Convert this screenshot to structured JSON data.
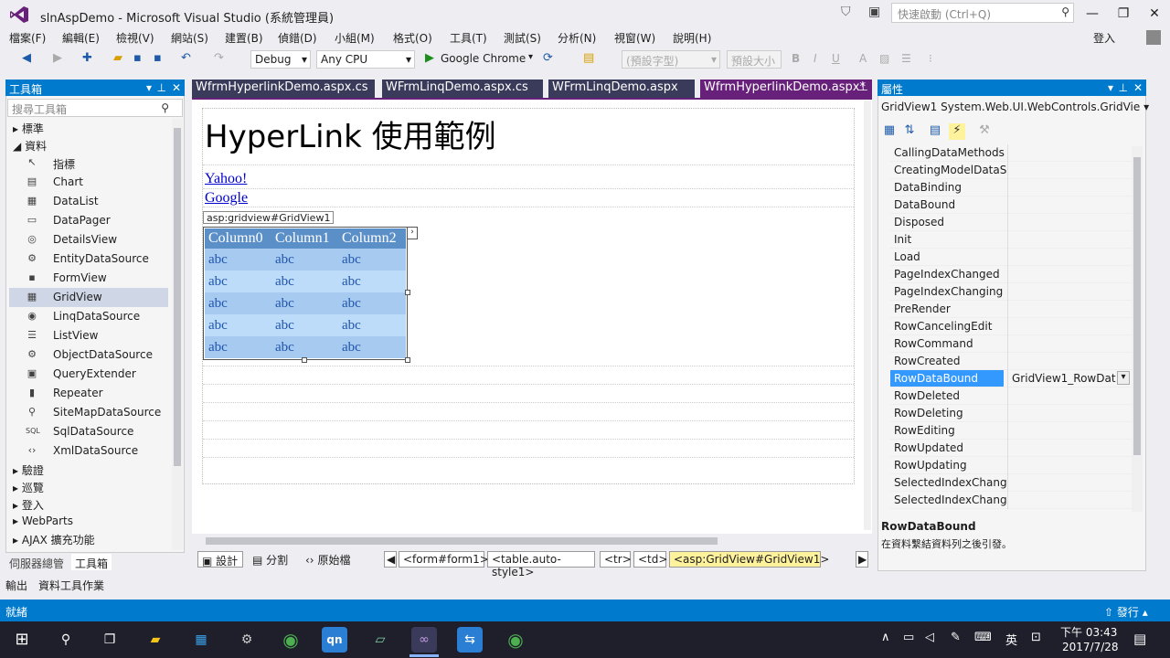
{
  "window": {
    "title": "slnAspDemo - Microsoft Visual Studio (系統管理員)",
    "quick_launch_placeholder": "快速啟動 (Ctrl+Q)",
    "signin": "登入"
  },
  "menu": [
    "檔案(F)",
    "編輯(E)",
    "檢視(V)",
    "網站(S)",
    "建置(B)",
    "偵錯(D)",
    "小組(M)",
    "格式(O)",
    "工具(T)",
    "測試(S)",
    "分析(N)",
    "視窗(W)",
    "說明(H)"
  ],
  "toolbar": {
    "config": "Debug",
    "platform": "Any CPU",
    "run_target": "Google Chrome",
    "style_select": "(預設字型)",
    "size_select": "預設大小"
  },
  "toolbox": {
    "title": "工具箱",
    "search_placeholder": "搜尋工具箱",
    "cat_standard": "標準",
    "cat_data": "資料",
    "items": [
      {
        "label": "指標",
        "icon": "pointer-icon",
        "glyph": "↖"
      },
      {
        "label": "Chart",
        "icon": "chart-icon",
        "glyph": "▤"
      },
      {
        "label": "DataList",
        "icon": "datalist-icon",
        "glyph": "▦"
      },
      {
        "label": "DataPager",
        "icon": "datapager-icon",
        "glyph": "▭"
      },
      {
        "label": "DetailsView",
        "icon": "detailsview-icon",
        "glyph": "◎"
      },
      {
        "label": "EntityDataSource",
        "icon": "entitydatasource-icon",
        "glyph": "⚙"
      },
      {
        "label": "FormView",
        "icon": "formview-icon",
        "glyph": "▪"
      },
      {
        "label": "GridView",
        "icon": "gridview-icon",
        "glyph": "▦"
      },
      {
        "label": "LinqDataSource",
        "icon": "linqdatasource-icon",
        "glyph": "◉"
      },
      {
        "label": "ListView",
        "icon": "listview-icon",
        "glyph": "☰"
      },
      {
        "label": "ObjectDataSource",
        "icon": "objectdatasource-icon",
        "glyph": "⚙"
      },
      {
        "label": "QueryExtender",
        "icon": "queryextender-icon",
        "glyph": "▣"
      },
      {
        "label": "Repeater",
        "icon": "repeater-icon",
        "glyph": "▮"
      },
      {
        "label": "SiteMapDataSource",
        "icon": "sitemapdatasource-icon",
        "glyph": "⚲"
      },
      {
        "label": "SqlDataSource",
        "icon": "sqldatasource-icon",
        "glyph": "SQL"
      },
      {
        "label": "XmlDataSource",
        "icon": "xmldatasource-icon",
        "glyph": "‹›"
      }
    ],
    "cat_validation": "驗證",
    "cat_navigation": "巡覽",
    "cat_login": "登入",
    "cat_webparts": "WebParts",
    "cat_ajax": "AJAX 擴充功能",
    "tab_server": "伺服器總管",
    "tab_toolbox": "工具箱"
  },
  "tabs": [
    "WfrmHyperlinkDemo.aspx.cs",
    "WFrmLinqDemo.aspx.cs",
    "WFrmLinqDemo.aspx",
    "WfrmHyperlinkDemo.aspx*"
  ],
  "design": {
    "heading": "HyperLink 使用範例",
    "link1": "Yahoo!",
    "link2": "Google",
    "grid_tag": "asp:gridview#GridView1",
    "grid_headers": [
      "Column0",
      "Column1",
      "Column2"
    ],
    "grid_cell": "abc"
  },
  "viewbar": {
    "design": "設計",
    "split": "分割",
    "source": "原始檔",
    "crumbs": [
      "<form#form1>",
      "<table.auto-style1>",
      "<tr>",
      "<td>",
      "<asp:GridView#GridView1>"
    ]
  },
  "properties": {
    "title": "屬性",
    "object": "GridView1  System.Web.UI.WebControls.GridVie",
    "rows": [
      "CallingDataMethods",
      "CreatingModelDataSc",
      "DataBinding",
      "DataBound",
      "Disposed",
      "Init",
      "Load",
      "PageIndexChanged",
      "PageIndexChanging",
      "PreRender",
      "RowCancelingEdit",
      "RowCommand",
      "RowCreated",
      "RowDataBound",
      "RowDeleted",
      "RowDeleting",
      "RowEditing",
      "RowUpdated",
      "RowUpdating",
      "SelectedIndexChange",
      "SelectedIndexChangir"
    ],
    "selected_value": "GridView1_RowDat",
    "desc_title": "RowDataBound",
    "desc_text": "在資料繫結資料列之後引發。"
  },
  "output_tabs": [
    "輸出",
    "資料工具作業"
  ],
  "status": {
    "left": "就緒",
    "right": "發行"
  },
  "tray": {
    "time": "下午 03:43",
    "date": "2017/7/28",
    "ime": "英"
  },
  "colors": {
    "accent": "#007acc",
    "vs_purple": "#68217a",
    "grid_header": "#5b8fc7",
    "grid_row": "#a6caf0",
    "grid_row_alt": "#bcdcfa"
  }
}
